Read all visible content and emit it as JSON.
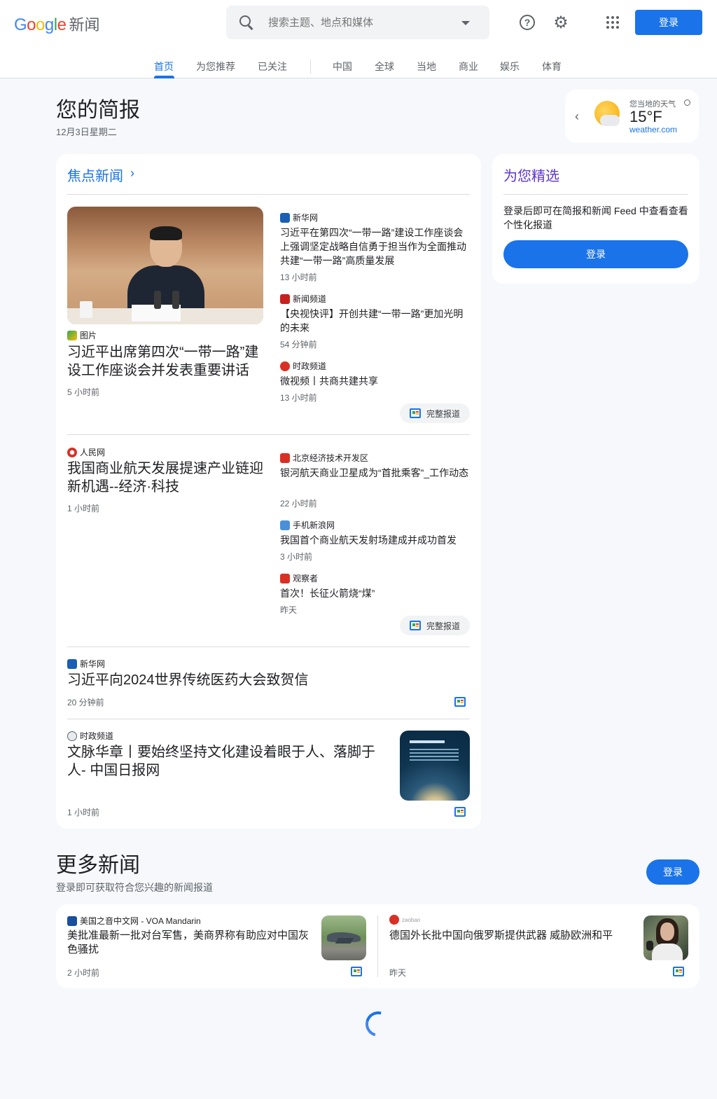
{
  "header": {
    "logo_letters": [
      "G",
      "o",
      "o",
      "g",
      "l",
      "e"
    ],
    "app_name": "新闻",
    "search_placeholder": "搜索主题、地点和媒体",
    "help_icon": "help-icon",
    "settings_icon": "gear-icon",
    "apps_icon": "apps-grid-icon",
    "signin_label": "登录"
  },
  "nav": {
    "tabs": [
      "首页",
      "为您推荐",
      "已关注",
      "中国",
      "全球",
      "当地",
      "商业",
      "娱乐",
      "体育"
    ],
    "active": "首页"
  },
  "briefing": {
    "title": "您的简报",
    "date": "12月3日星期二"
  },
  "weather": {
    "label": "您当地的天气",
    "temp": "15°F",
    "source": "weather.com"
  },
  "top_stories": {
    "title": "焦点新闻",
    "full_coverage_label": "完整报道",
    "clusters": [
      {
        "main": {
          "source": "图片",
          "headline": "习近平出席第四次“一带一路”建设工作座谈会并发表重要讲话",
          "time": "5 小时前"
        },
        "related": [
          {
            "source": "新华网",
            "headline": "习近平在第四次“一带一路”建设工作座谈会上强调坚定战略自信勇于担当作为全面推动共建“一带一路”高质量发展",
            "time": "13 小时前"
          },
          {
            "source": "新闻频道",
            "headline": "【央视快评】开创共建“一带一路”更加光明的未来",
            "time": "54 分钟前"
          },
          {
            "source": "时政频道",
            "headline": "微视频丨共商共建共享",
            "time": "13 小时前"
          }
        ]
      },
      {
        "main": {
          "source": "人民网",
          "headline": "我国商业航天发展提速产业链迎新机遇--经济·科技",
          "time": "1 小时前"
        },
        "related": [
          {
            "source": "北京经济技术开发区",
            "headline": "银河航天商业卫星成为“首批乘客”_工作动态",
            "time": "22 小时前"
          },
          {
            "source": "手机新浪网",
            "headline": "我国首个商业航天发射场建成并成功首发",
            "time": "3 小时前"
          },
          {
            "source": "观察者",
            "headline": "首次！长征火箭烧“煤”",
            "time": "昨天"
          }
        ]
      },
      {
        "main": {
          "source": "新华网",
          "headline": "习近平向2024世界传统医药大会致贺信",
          "time": "20 分钟前"
        }
      },
      {
        "main": {
          "source": "时政频道",
          "headline": "文脉华章丨要始终坚持文化建设着眼于人、落脚于人- 中国日报网",
          "time": "1 小时前"
        }
      }
    ]
  },
  "picks": {
    "title": "为您精选",
    "text": "登录后即可在简报和新闻 Feed 中查看查看个性化报道",
    "button": "登录"
  },
  "more_news": {
    "title": "更多新闻",
    "subtitle": "登录即可获取符合您兴趣的新闻报道",
    "button": "登录",
    "items": [
      {
        "source": "美国之音中文网 - VOA Mandarin",
        "headline": "美批准最新一批对台军售，美商界称有助应对中国灰色骚扰",
        "time": "2 小时前"
      },
      {
        "source": "zaobao",
        "headline": "德国外长批中国向俄罗斯提供武器 威胁欧洲和平",
        "time": "昨天"
      }
    ]
  },
  "colors": {
    "accent": "#1a73e8",
    "picks_title": "#5e35d1",
    "page_bg": "#f6f8fc"
  }
}
